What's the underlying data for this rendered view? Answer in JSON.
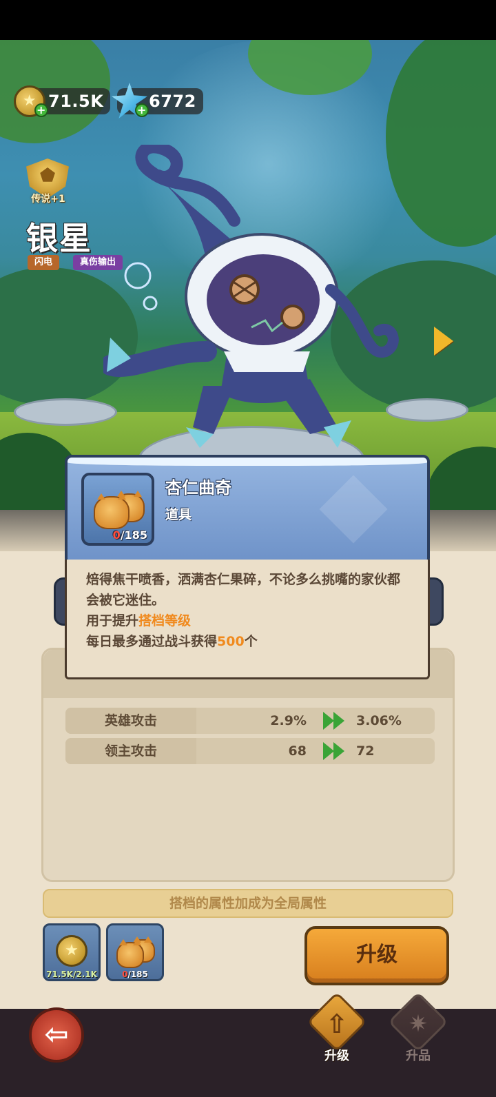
{
  "currency": {
    "gold": "71.5K",
    "crystal": "6772"
  },
  "hero": {
    "rank_label": "传说+1",
    "name": "银星",
    "element_tag": "闪电",
    "role_tag": "真伤输出"
  },
  "stats": [
    {
      "name": "英雄攻击",
      "from": "2.9%",
      "to": "3.06%"
    },
    {
      "name": "领主攻击",
      "from": "68",
      "to": "72"
    }
  ],
  "global_note": "搭档的属性加成为全局属性",
  "costs": {
    "gold": "71.5K/2.1K",
    "cookie_have": "0",
    "cookie_need": "/185"
  },
  "upgrade_button": "升级",
  "nav": {
    "upgrade": "升级",
    "rankup": "升品"
  },
  "popup": {
    "item_name": "杏仁曲奇",
    "item_type": "道具",
    "count_have": "0",
    "count_need": "/185",
    "description": "焙得焦干喷香，洒满杏仁果碎，不论多么挑嘴的家伙都会被它迷住。",
    "usage_prefix": "用于提升",
    "usage_highlight": "搭档等级",
    "limit_prefix": "每日最多通过战斗获得",
    "limit_value": "500",
    "limit_suffix": "个"
  },
  "colors": {
    "highlight": "#f08a1e",
    "zero_count": "#ff4d3d",
    "upgrade_button": "#e8922a",
    "popup_header": "#7e9fd2"
  },
  "icons": [
    "gold-coin-icon",
    "crystal-icon",
    "plus-icon",
    "rank-shield-icon",
    "next-arrow-icon",
    "cookie-icon",
    "back-arrow-icon",
    "upgrade-arrow-icon",
    "rankup-gear-icon"
  ]
}
